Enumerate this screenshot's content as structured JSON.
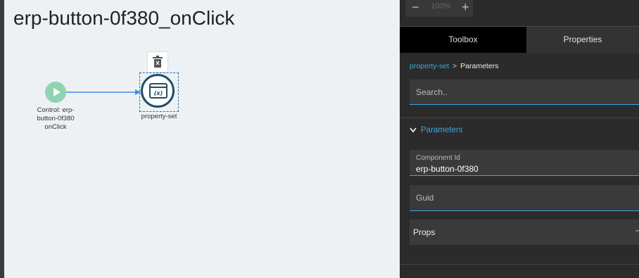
{
  "canvas": {
    "title": "erp-button-0f380_onClick",
    "start_node_label": "Control: erp-button-0f380 onClick",
    "action_node_label": "property-set"
  },
  "zoom": {
    "minus": "−",
    "value": "100%",
    "plus": "+"
  },
  "tabs": [
    {
      "label": "Toolbox",
      "active": false
    },
    {
      "label": "Properties",
      "active": true
    }
  ],
  "breadcrumb": {
    "link": "property-set",
    "separator": ">",
    "current": "Parameters"
  },
  "search": {
    "placeholder": "Search.."
  },
  "section": {
    "title": "Parameters",
    "icon": "chevron-down-icon"
  },
  "fields": {
    "component_id": {
      "label": "Component Id",
      "value": "erp-button-0f380"
    },
    "guid": {
      "placeholder": "Guid"
    },
    "props": {
      "label": "Props",
      "more": "···"
    }
  },
  "colors": {
    "accent": "#3aa7e3",
    "start_node": "#8fd3b3",
    "action_node_border": "#1d4f66",
    "canvas_bg": "#edf1f4",
    "panel_bg": "#2b2b2b"
  }
}
